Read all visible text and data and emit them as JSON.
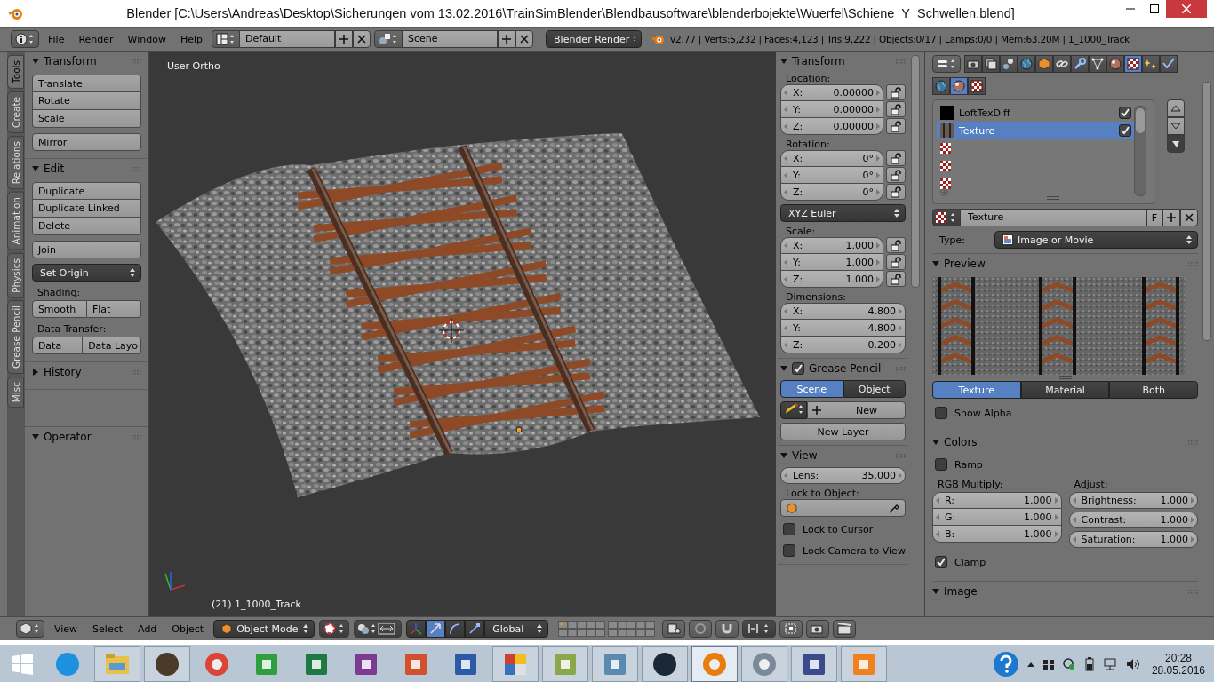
{
  "window": {
    "title": "Blender [C:\\Users\\Andreas\\Desktop\\Sicherungen vom 13.02.2016\\TrainSimBlender\\Blendbausoftware\\blenderbojekte\\Wuerfel\\Schiene_Y_Schwellen.blend]"
  },
  "info_header": {
    "menus": [
      "File",
      "Render",
      "Window",
      "Help"
    ],
    "layout": "Default",
    "scene": "Scene",
    "engine": "Blender Render",
    "stats": "v2.77 | Verts:5,232 | Faces:4,123 | Tris:9,222 | Objects:0/17 | Lamps:0/0 | Mem:63.20M | 1_1000_Track"
  },
  "tool_shelf": {
    "tabs": [
      {
        "label": "Tools",
        "selected": true
      },
      {
        "label": "Create",
        "selected": false
      },
      {
        "label": "Relations",
        "selected": false
      },
      {
        "label": "Animation",
        "selected": false
      },
      {
        "label": "Physics",
        "selected": false
      },
      {
        "label": "Grease Pencil",
        "selected": false
      },
      {
        "label": "Misc",
        "selected": false
      }
    ],
    "panels": [
      {
        "title": "Transform",
        "expanded": true,
        "items": [
          {
            "kind": "stack",
            "buttons": [
              "Translate",
              "Rotate",
              "Scale"
            ]
          },
          {
            "kind": "stack",
            "buttons": [
              "Mirror"
            ]
          }
        ]
      },
      {
        "title": "Edit",
        "expanded": true,
        "items": [
          {
            "kind": "stack",
            "buttons": [
              "Duplicate",
              "Duplicate Linked",
              "Delete"
            ]
          },
          {
            "kind": "stack",
            "buttons": [
              "Join"
            ]
          },
          {
            "kind": "dropdown",
            "value": "Set Origin"
          },
          {
            "kind": "label",
            "text": "Shading:"
          },
          {
            "kind": "row",
            "buttons": [
              "Smooth",
              "Flat"
            ]
          },
          {
            "kind": "label",
            "text": "Data Transfer:"
          },
          {
            "kind": "row",
            "buttons": [
              "Data",
              "Data Layo"
            ]
          }
        ]
      },
      {
        "title": "History",
        "expanded": false
      }
    ],
    "operator": {
      "title": "Operator",
      "expanded": true
    }
  },
  "viewport": {
    "view_name": "User Ortho",
    "object_info": "(21) 1_1000_Track"
  },
  "n_panel": {
    "panels": [
      {
        "title": "Transform",
        "expanded": true,
        "items": [
          {
            "kind": "label",
            "text": "Location:"
          },
          {
            "kind": "vector",
            "locks": true,
            "fields": [
              {
                "label": "X:",
                "value": "0.00000"
              },
              {
                "label": "Y:",
                "value": "0.00000"
              },
              {
                "label": "Z:",
                "value": "0.00000"
              }
            ]
          },
          {
            "kind": "label",
            "text": "Rotation:"
          },
          {
            "kind": "vector",
            "locks": true,
            "fields": [
              {
                "label": "X:",
                "value": "0°"
              },
              {
                "label": "Y:",
                "value": "0°"
              },
              {
                "label": "Z:",
                "value": "0°"
              }
            ]
          },
          {
            "kind": "dropdown",
            "value": "XYZ Euler"
          },
          {
            "kind": "label",
            "text": "Scale:"
          },
          {
            "kind": "vector",
            "locks": true,
            "fields": [
              {
                "label": "X:",
                "value": "1.000"
              },
              {
                "label": "Y:",
                "value": "1.000"
              },
              {
                "label": "Z:",
                "value": "1.000"
              }
            ]
          },
          {
            "kind": "label",
            "text": "Dimensions:"
          },
          {
            "kind": "vector",
            "locks": false,
            "fields": [
              {
                "label": "X:",
                "value": "4.800"
              },
              {
                "label": "Y:",
                "value": "4.800"
              },
              {
                "label": "Z:",
                "value": "0.200"
              }
            ]
          }
        ]
      },
      {
        "title": "Grease Pencil",
        "expanded": true,
        "enabled": true,
        "items": [
          {
            "kind": "toggle",
            "options": [
              {
                "label": "Scene",
                "selected": true
              },
              {
                "label": "Object",
                "selected": false
              }
            ]
          },
          {
            "kind": "new",
            "label": "New"
          },
          {
            "kind": "button",
            "label": "New Layer"
          }
        ]
      },
      {
        "title": "View",
        "expanded": true,
        "items": [
          {
            "kind": "vector",
            "locks": false,
            "fields": [
              {
                "label": "Lens:",
                "value": "35.000"
              }
            ]
          },
          {
            "kind": "label",
            "text": "Lock to Object:"
          },
          {
            "kind": "object_field"
          },
          {
            "kind": "checkbox",
            "label": "Lock to Cursor",
            "checked": false
          },
          {
            "kind": "checkbox",
            "label": "Lock Camera to View",
            "checked": false
          }
        ]
      }
    ]
  },
  "properties": {
    "context_tabs": [
      {
        "kind": "render",
        "selected": false
      },
      {
        "kind": "layers",
        "selected": false
      },
      {
        "kind": "scene",
        "selected": false
      },
      {
        "kind": "world",
        "selected": false
      },
      {
        "kind": "object",
        "selected": false
      },
      {
        "kind": "constraints",
        "selected": false
      },
      {
        "kind": "modifiers",
        "selected": false
      },
      {
        "kind": "data",
        "selected": false
      },
      {
        "kind": "material",
        "selected": false
      },
      {
        "kind": "texture",
        "selected": true
      },
      {
        "kind": "particles",
        "selected": false
      },
      {
        "kind": "physics",
        "selected": false
      }
    ],
    "texture_context": [
      {
        "kind": "world",
        "selected": false
      },
      {
        "kind": "material",
        "selected": true
      },
      {
        "kind": "texture",
        "selected": false
      }
    ],
    "slots": [
      {
        "kind": "black",
        "name": "LoftTexDiff",
        "checked": true,
        "selected": false
      },
      {
        "kind": "image",
        "name": "Texture",
        "checked": true,
        "selected": true
      },
      {
        "kind": "empty",
        "selected": false
      },
      {
        "kind": "empty",
        "selected": false
      },
      {
        "kind": "empty",
        "selected": false
      }
    ],
    "datablock": {
      "name": "Texture",
      "fake_user": "F"
    },
    "type": {
      "label": "Type:",
      "value": "Image or Movie"
    },
    "panels": [
      {
        "title": "Preview",
        "expanded": true,
        "items": [
          {
            "kind": "preview"
          },
          {
            "kind": "toggle",
            "options": [
              {
                "label": "Texture",
                "selected": true
              },
              {
                "label": "Material",
                "selected": false
              },
              {
                "label": "Both",
                "selected": false
              }
            ]
          },
          {
            "kind": "checkbox",
            "label": "Show Alpha",
            "checked": false
          }
        ]
      },
      {
        "title": "Colors",
        "expanded": true,
        "items": [
          {
            "kind": "checkbox",
            "label": "Ramp",
            "checked": false
          },
          {
            "kind": "columns",
            "columns": [
              {
                "label": "RGB Multiply:",
                "fields": [
                  {
                    "label": "R:",
                    "value": "1.000"
                  },
                  {
                    "label": "G:",
                    "value": "1.000"
                  },
                  {
                    "label": "B:",
                    "value": "1.000"
                  }
                ]
              },
              {
                "label": "Adjust:",
                "fields": [
                  {
                    "label": "Brightness:",
                    "value": "1.000"
                  },
                  {
                    "label": "Contrast:",
                    "value": "1.000"
                  },
                  {
                    "label": "Saturation:",
                    "value": "1.000"
                  }
                ]
              }
            ]
          },
          {
            "kind": "checkbox",
            "label": "Clamp",
            "checked": true
          }
        ]
      },
      {
        "title": "Image",
        "expanded": true
      }
    ]
  },
  "view_header": {
    "menus": [
      "View",
      "Select",
      "Add",
      "Object"
    ],
    "mode": "Object Mode",
    "manipulators": [
      {
        "kind": "translate",
        "selected": true
      },
      {
        "kind": "rotate",
        "selected": false
      },
      {
        "kind": "scale",
        "selected": false
      }
    ],
    "orientation": "Global"
  },
  "taskbar": {
    "apps": [
      {
        "kind": "ie",
        "running": false,
        "active": false
      },
      {
        "kind": "explorer",
        "running": true,
        "active": false
      },
      {
        "kind": "speaker",
        "running": true,
        "active": false
      },
      {
        "kind": "chrome",
        "running": false,
        "active": false
      },
      {
        "kind": "store",
        "running": false,
        "active": false
      },
      {
        "kind": "excel",
        "running": false,
        "active": false
      },
      {
        "kind": "onenote",
        "running": false,
        "active": false
      },
      {
        "kind": "powerpoint",
        "running": false,
        "active": false
      },
      {
        "kind": "word",
        "running": false,
        "active": false
      },
      {
        "kind": "tiles",
        "running": true,
        "active": false
      },
      {
        "kind": "notepad",
        "running": true,
        "active": false
      },
      {
        "kind": "photos",
        "running": true,
        "active": false
      },
      {
        "kind": "steam",
        "running": true,
        "active": false
      },
      {
        "kind": "blender",
        "running": true,
        "active": true
      },
      {
        "kind": "settings",
        "running": true,
        "active": false
      },
      {
        "kind": "paint",
        "running": true,
        "active": false
      },
      {
        "kind": "media",
        "running": true,
        "active": false
      }
    ],
    "clock": {
      "time": "20:28",
      "date": "28.05.2016"
    }
  }
}
